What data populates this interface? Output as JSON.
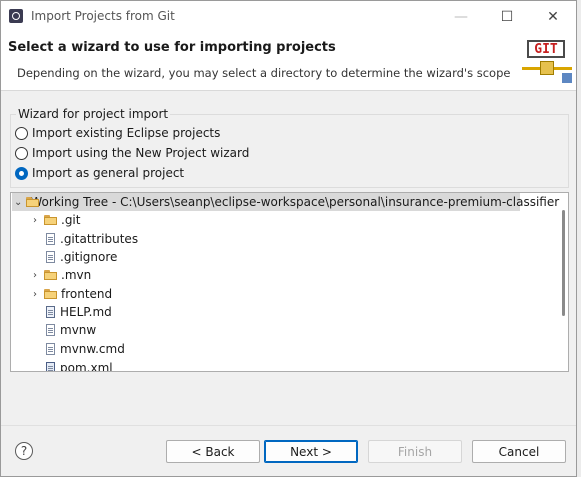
{
  "window": {
    "title": "Import Projects from Git",
    "minimize_glyph": "—",
    "maximize_glyph": "☐",
    "close_glyph": "✕"
  },
  "header": {
    "title": "Select a wizard to use for importing projects",
    "description": "Depending on the wizard, you may select a directory to determine the wizard's scope",
    "logo_text": "GIT"
  },
  "wizard_group": {
    "label": "Wizard for project import",
    "options": [
      {
        "label": "Import existing Eclipse projects",
        "checked": false
      },
      {
        "label": "Import using the New Project wizard",
        "checked": false
      },
      {
        "label": "Import as general project",
        "checked": true
      }
    ]
  },
  "tree": {
    "root": {
      "label": "Working Tree - C:\\Users\\seanp\\eclipse-workspace\\personal\\insurance-premium-classifier",
      "expanded": true
    },
    "children": [
      {
        "label": ".git",
        "type": "folder",
        "expandable": true
      },
      {
        "label": ".gitattributes",
        "type": "file"
      },
      {
        "label": ".gitignore",
        "type": "file"
      },
      {
        "label": ".mvn",
        "type": "folder",
        "expandable": true
      },
      {
        "label": "frontend",
        "type": "folder",
        "expandable": true
      },
      {
        "label": "HELP.md",
        "type": "md"
      },
      {
        "label": "mvnw",
        "type": "file"
      },
      {
        "label": "mvnw.cmd",
        "type": "file"
      },
      {
        "label": "pom.xml",
        "type": "xml"
      }
    ],
    "expand_chevron": "›",
    "collapse_chevron": "⌄"
  },
  "footer": {
    "help_glyph": "?",
    "back_label": "< Back",
    "next_label": "Next >",
    "finish_label": "Finish",
    "cancel_label": "Cancel"
  }
}
